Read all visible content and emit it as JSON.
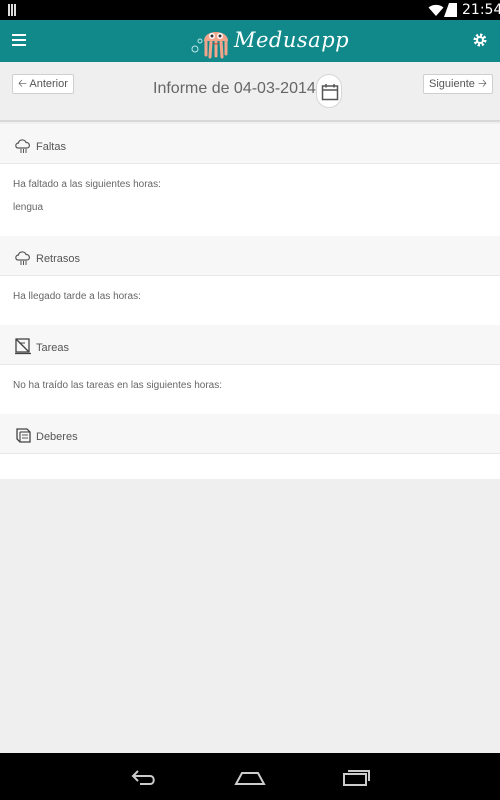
{
  "status_bar": {
    "time": "21:54"
  },
  "app_bar": {
    "brand": "Medusapp"
  },
  "nav": {
    "prev_label": "Anterior",
    "next_label": "Siguiente",
    "title": "Informe de 04-03-2014"
  },
  "sections": {
    "faltas": {
      "title": "Faltas",
      "intro": "Ha faltado a las siguientes horas:",
      "items": [
        "lengua"
      ]
    },
    "retrasos": {
      "title": "Retrasos",
      "intro": "Ha llegado tarde a las horas:"
    },
    "tareas": {
      "title": "Tareas",
      "intro": "No ha traído las tareas en las siguientes horas:"
    },
    "deberes": {
      "title": "Deberes"
    }
  },
  "colors": {
    "accent": "#11898b",
    "background": "#efefef"
  },
  "icons": {
    "menu": "menu-icon",
    "settings": "gear-icon",
    "calendar": "calendar-icon",
    "faltas": "cloud-icon",
    "retrasos": "cloud-icon",
    "tareas": "homework-icon",
    "deberes": "book-icon"
  }
}
